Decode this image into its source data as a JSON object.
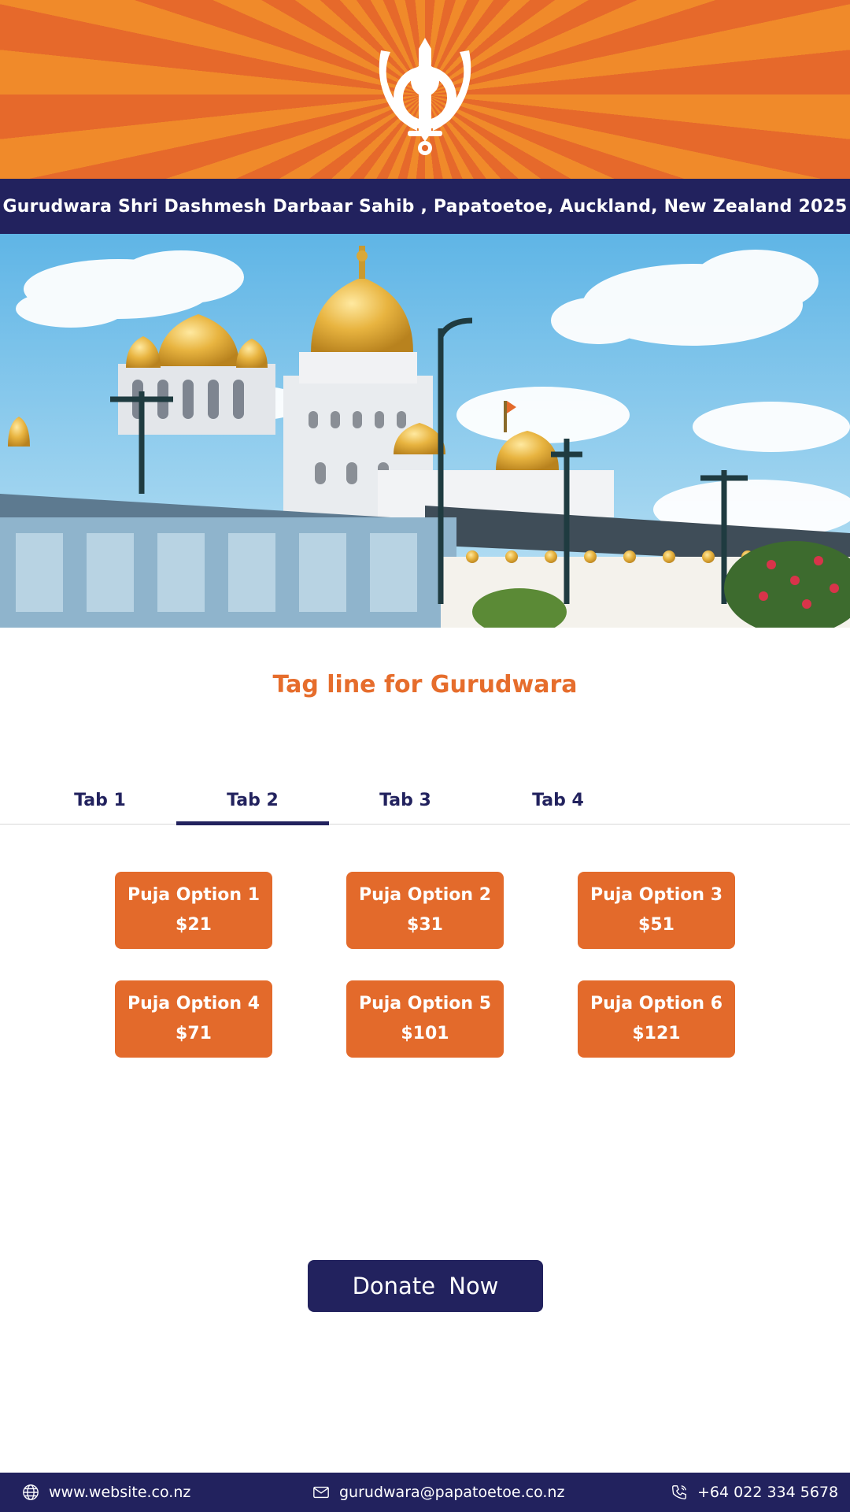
{
  "header": {
    "logo_icon": "khanda-icon",
    "title": "Gurudwara Shri Dashmesh Darbaar Sahib , Papatoetoe, Auckland, New Zealand 2025"
  },
  "hero": {
    "image": "gurudwara-photo"
  },
  "tagline": "Tag line for Gurudwara",
  "tabs": [
    {
      "label": "Tab 1",
      "active": false
    },
    {
      "label": "Tab 2",
      "active": true
    },
    {
      "label": "Tab 3",
      "active": false
    },
    {
      "label": "Tab 4",
      "active": false
    }
  ],
  "options": [
    {
      "name": "Puja Option 1",
      "price": "$21"
    },
    {
      "name": "Puja Option 2",
      "price": "$31"
    },
    {
      "name": "Puja Option 3",
      "price": "$51"
    },
    {
      "name": "Puja Option 4",
      "price": "$71"
    },
    {
      "name": "Puja Option 5",
      "price": "$101"
    },
    {
      "name": "Puja Option 6",
      "price": "$121"
    }
  ],
  "donate": {
    "label": "Donate Now"
  },
  "footer": {
    "website": "www.website.co.nz",
    "email": "gurudwara@papatoetoe.co.nz",
    "phone": "+64 022 334 5678"
  },
  "colors": {
    "orange": "#e36a2b",
    "navy": "#22225e"
  }
}
